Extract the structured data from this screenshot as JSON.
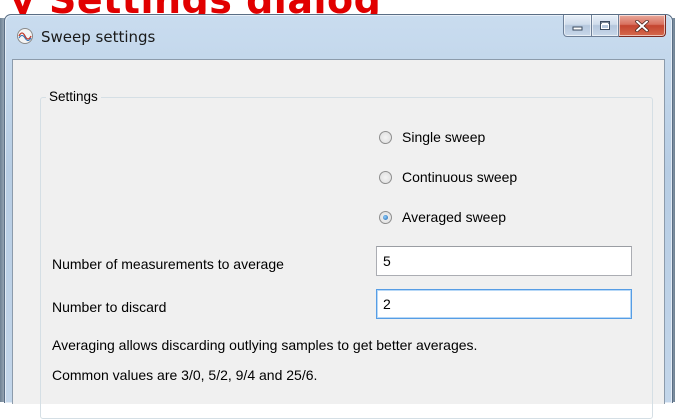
{
  "background": {
    "banner_text": "y Settings dialog"
  },
  "window": {
    "title": "Sweep settings",
    "icon": "sweep-app-icon",
    "caption_buttons": [
      "minimize",
      "maximize",
      "close"
    ]
  },
  "settings": {
    "group_label": "Settings",
    "sweep_modes": [
      {
        "label": "Single sweep",
        "selected": false
      },
      {
        "label": "Continuous sweep",
        "selected": false
      },
      {
        "label": "Averaged sweep",
        "selected": true
      }
    ],
    "measurements_label": "Number of measurements to average",
    "measurements_value": "5",
    "discard_label": "Number to discard",
    "discard_value": "2",
    "note_line1": "Averaging allows discarding outlying samples to get better averages.",
    "note_line2": "Common values are 3/0, 5/2, 9/4 and 25/6."
  },
  "colors": {
    "banner": "#e10000",
    "close_button": "#c4442f",
    "focus_border": "#569de5"
  }
}
